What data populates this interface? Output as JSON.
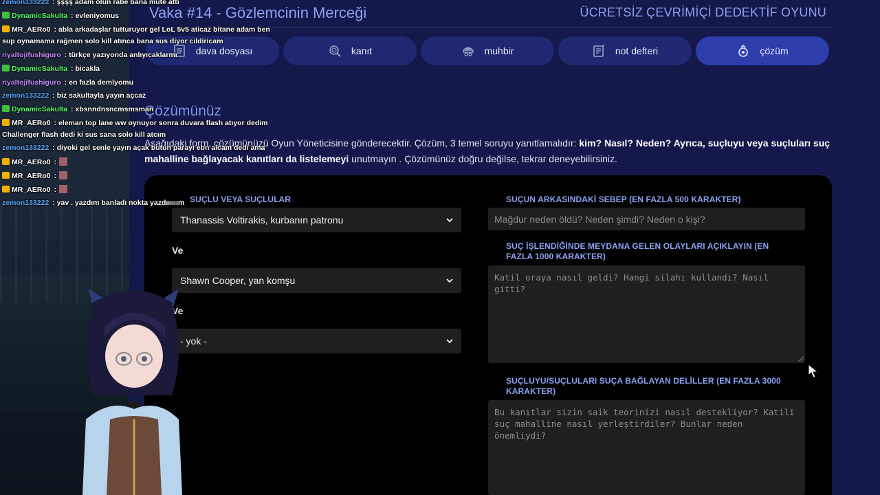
{
  "header": {
    "case_title": "Vaka #14 - Gözlemcinin Merceği",
    "brand": "ÜCRETSİZ ÇEVRİMİÇİ DEDEKTİF OYUNU"
  },
  "tabs": [
    {
      "label": "dava dosyası",
      "icon": "folder-icon"
    },
    {
      "label": "kanıt",
      "icon": "fingerprint-icon"
    },
    {
      "label": "muhbir",
      "icon": "informant-icon"
    },
    {
      "label": "not defteri",
      "icon": "notebook-icon"
    },
    {
      "label": "çözüm",
      "icon": "solution-icon",
      "active": true
    }
  ],
  "solution": {
    "title": "Çözümünüz",
    "intro_1": "Aşağıdaki form, çözümünüzü Oyun Yöneticisine gönderecektir. Çözüm, 3 temel soruyu yanıtlamalıdır: ",
    "intro_bold_1": "kim? Nasıl? Neden? Ayrıca, suçluyu veya suçluları suç mahalline bağlayacak kanıtları da listelemeyi",
    "intro_2": " unutmayın . Çözümünüz doğru değilse, tekrar deneyebilirsiniz."
  },
  "form": {
    "culprits_label": "SUÇLU VEYA SUÇLULAR",
    "culprit_1": "Thanassis Voltirakis, kurbanın patronu",
    "and_1": "Ve",
    "culprit_2": "Shawn Cooper, yan komşu",
    "and_2": "Ve",
    "culprit_3": "- yok -",
    "motive_label": "SUÇUN ARKASINDAKİ SEBEP (EN FAZLA 500 KARAKTER)",
    "motive_placeholder": "Mağdur neden öldü? Neden şimdi? Neden o kişi?",
    "events_label": "SUÇ İŞLENDİĞİNDE MEYDANA GELEN OLAYLARI AÇIKLAYIN (EN FAZLA 1000 KARAKTER)",
    "events_placeholder": "Katil oraya nasıl geldi? Hangi silahı kullandı? Nasıl gitti?",
    "evidence_label": "SUÇLUYU/SUÇLULARI SUÇA BAĞLAYAN DELİLLER (EN FAZLA 3000 KARAKTER)",
    "evidence_placeholder": "Bu kanıtlar sizin saik teorinizi nasıl destekliyor? Katili suç mahalline nasıl yerleştirdiler? Bunlar neden önemliydi?"
  },
  "chat": [
    {
      "user": "zemon133222",
      "color": "#5aa8ff",
      "text": "şşşş adam ölün rabe bana mute attı",
      "badge": ""
    },
    {
      "user": "DynamicSakulta",
      "color": "#58ff6a",
      "text": "evleniyomus",
      "badge": "mod"
    },
    {
      "user": "MR_AERo0",
      "color": "#ffffff",
      "text": "abla arkadaşlar tutturuyor gel LoL 5v5 aticaz bitane adam ben",
      "badge": "crown"
    },
    {
      "user": "",
      "color": "#ffffff",
      "text": "sup oynamama rağmen solo kill atınca bana sus diyor cildiricam",
      "badge": ""
    },
    {
      "user": "riyaltojifushiguro",
      "color": "#c98cff",
      "text": "türkçe yazıyonda anlıyıcaklarmı",
      "badge": ""
    },
    {
      "user": "DynamicSakulta",
      "color": "#58ff6a",
      "text": "bicakla",
      "badge": "mod"
    },
    {
      "user": "riyaltojifushiguro",
      "color": "#c98cff",
      "text": "en fazla demlyomu",
      "badge": ""
    },
    {
      "user": "zemon133222",
      "color": "#5aa8ff",
      "text": "biz sakultayla yayın açcaz",
      "badge": ""
    },
    {
      "user": "DynamicSakulta",
      "color": "#58ff6a",
      "text": "xbsnndnsncmsmsman",
      "badge": "mod"
    },
    {
      "user": "MR_AERo0",
      "color": "#ffffff",
      "text": "eleman top lane ww oynuyor sonra duvara flash atıyor dedim",
      "badge": "crown"
    },
    {
      "user": "",
      "color": "#ffffff",
      "text": "Challenger flash dedi ki sus sana solo kill atcım",
      "badge": ""
    },
    {
      "user": "zemon133222",
      "color": "#5aa8ff",
      "text": "diyoki gel senle yayın açak butun parayı ebn alcam dedi ama",
      "badge": ""
    },
    {
      "user": "MR_AERo0",
      "color": "#ffffff",
      "text": "",
      "badge": "crown",
      "emote": true
    },
    {
      "user": "MR_AERo0",
      "color": "#ffffff",
      "text": "",
      "badge": "crown",
      "emote": true
    },
    {
      "user": "MR_AERo0",
      "color": "#ffffff",
      "text": "",
      "badge": "crown",
      "emote": true
    },
    {
      "user": "zemon133222",
      "color": "#5aa8ff",
      "text": "yav . yazdım banladı nokta yazdıııııım",
      "badge": ""
    }
  ],
  "colors": {
    "page_bg": "#14184a",
    "tab_bg": "#1f2870",
    "tab_active_bg": "#2d3dac",
    "accent": "#8aa2f0",
    "panel_bg": "#000000"
  }
}
